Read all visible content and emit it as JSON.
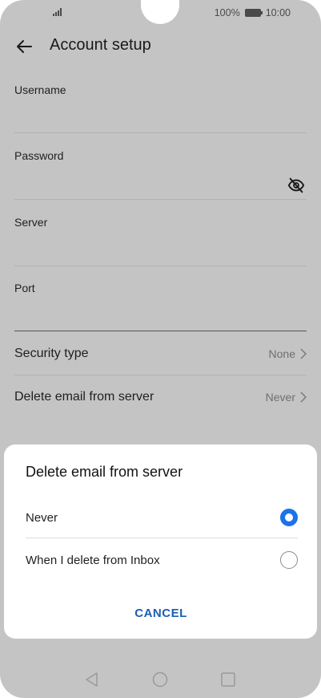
{
  "status_bar": {
    "battery": "100%",
    "time": "10:00"
  },
  "header": {
    "title": "Account setup"
  },
  "form": {
    "username_label": "Username",
    "password_label": "Password",
    "server_label": "Server",
    "port_label": "Port"
  },
  "settings": {
    "security_type": {
      "label": "Security type",
      "value": "None"
    },
    "delete_email": {
      "label": "Delete email from server",
      "value": "Never"
    }
  },
  "dialog": {
    "title": "Delete email from server",
    "options": [
      {
        "label": "Never",
        "selected": true
      },
      {
        "label": "When I delete from Inbox",
        "selected": false
      }
    ],
    "cancel_label": "CANCEL"
  },
  "colors": {
    "accent": "#1a73e8",
    "cancel": "#1a5fb4",
    "scrim": "#c4c4c4"
  }
}
